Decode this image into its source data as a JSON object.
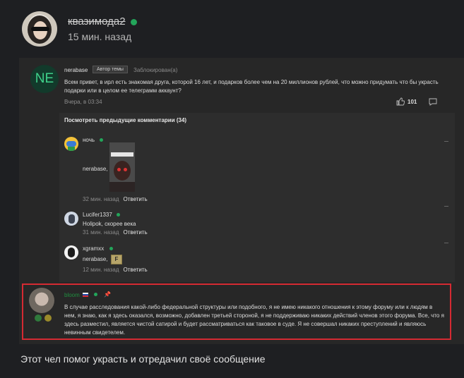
{
  "post": {
    "author": "квазимода2",
    "time": "15 мин. назад",
    "caption": "Этот чел помог украсть и отредачил своё сообщение"
  },
  "forum": {
    "topic": {
      "avatar_text": "NE",
      "author": "nerabase",
      "badge": "Автор темы",
      "status": "Заблокирован(а)",
      "text": "Всем привет, в ирл есть знакомая друга, которой 16 лет, и подарков более чем на 20 миллионов рублей, что можно придумать что бы украсть подарки или в целом ее телеграмм аккаунт?",
      "time": "Вчера, в 03:34",
      "likes": "101"
    },
    "prev_comments_label": "Посмотреть предыдущие комментарии (34)",
    "reply_label": "Ответить",
    "comments": [
      {
        "name": "ночь",
        "text": "nerabase,",
        "time": "32 мин. назад"
      },
      {
        "name": "Lucifer1337",
        "text": "Holipok, скорее века",
        "time": "31 мин. назад"
      },
      {
        "name": "xgramxx",
        "text": "nerabase,",
        "sticker": "F",
        "time": "12 мин. назад"
      }
    ],
    "highlighted": {
      "name": "bloom",
      "text": "В случае расследования какой-либо федеральной структуры или подобного, я не имею никакого отношения к этому форуму или к людям в нем, я знаю, как я здесь оказался, возможно, добавлен третьей стороной, я не поддерживаю никаких действий членов этого форума. Все, что я здесь разместил, является чистой сатирой и будет рассматриваться как таковое в суде. Я не совершал никаких преступлений и являюсь невинным свидетелем."
    }
  },
  "colors": {
    "online": "#23a55a",
    "highlight_border": "#d52a32",
    "ne_avatar": "#3fd08a"
  }
}
